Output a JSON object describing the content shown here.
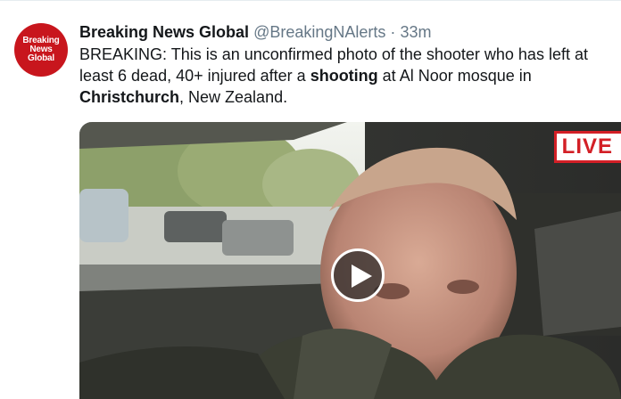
{
  "tweet": {
    "avatar": {
      "line1": "Breaking News",
      "line2": "Global",
      "bg_color": "#c8161d"
    },
    "display_name": "Breaking News Global",
    "handle": "@BreakingNAlerts",
    "separator": "·",
    "time": "33m",
    "text": {
      "part1": "BREAKING: This is an unconfirmed photo of the shooter who has left at least 6 dead, 40+ injured after a ",
      "bold1": "shooting",
      "part2": " at Al Noor mosque in ",
      "bold2": "Christchurch",
      "part3": ", New Zealand."
    },
    "media": {
      "type": "video",
      "live_label": "LIVE",
      "play_icon": "play-icon",
      "live_color": "#d31f26"
    }
  }
}
